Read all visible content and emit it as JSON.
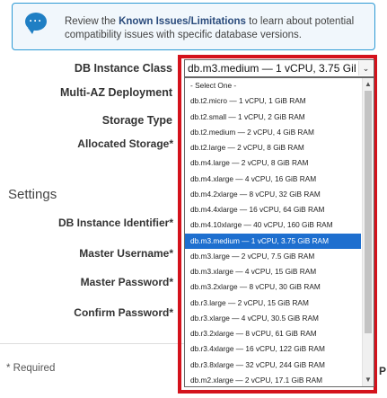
{
  "notice": {
    "icon": "speech-bubble-icon",
    "text_before": "Review the ",
    "link": "Known Issues/Limitations",
    "text_after": " to learn about potential compatibility issues with specific database versions."
  },
  "form": {
    "db_instance_class_label": "DB Instance Class",
    "multi_az_label": "Multi-AZ Deployment",
    "storage_type_label": "Storage Type",
    "allocated_storage_label": "Allocated Storage*",
    "section_settings": "Settings",
    "db_instance_identifier_label": "DB Instance Identifier*",
    "master_username_label": "Master Username*",
    "master_password_label": "Master Password*",
    "confirm_password_label": "Confirm Password*",
    "required_note": "* Required",
    "edge_fragment": "P"
  },
  "select": {
    "value": "db.m3.medium — 1 vCPU, 3.75 GiB RAM",
    "selected_index": 10,
    "options": [
      "- Select One -",
      "db.t2.micro — 1 vCPU, 1 GiB RAM",
      "db.t2.small — 1 vCPU, 2 GiB RAM",
      "db.t2.medium — 2 vCPU, 4 GiB RAM",
      "db.t2.large — 2 vCPU, 8 GiB RAM",
      "db.m4.large — 2 vCPU, 8 GiB RAM",
      "db.m4.xlarge — 4 vCPU, 16 GiB RAM",
      "db.m4.2xlarge — 8 vCPU, 32 GiB RAM",
      "db.m4.4xlarge — 16 vCPU, 64 GiB RAM",
      "db.m4.10xlarge — 40 vCPU, 160 GiB RAM",
      "db.m3.medium — 1 vCPU, 3.75 GiB RAM",
      "db.m3.large — 2 vCPU, 7.5 GiB RAM",
      "db.m3.xlarge — 4 vCPU, 15 GiB RAM",
      "db.m3.2xlarge — 8 vCPU, 30 GiB RAM",
      "db.r3.large — 2 vCPU, 15 GiB RAM",
      "db.r3.xlarge — 4 vCPU, 30.5 GiB RAM",
      "db.r3.2xlarge — 8 vCPU, 61 GiB RAM",
      "db.r3.4xlarge — 16 vCPU, 122 GiB RAM",
      "db.r3.8xlarge — 32 vCPU, 244 GiB RAM",
      "db.m2.xlarge — 2 vCPU, 17.1 GiB RAM"
    ]
  },
  "colors": {
    "highlight_border": "#d4121c",
    "selected_option": "#1e6fcf",
    "notice_border": "#2d9ad5",
    "link": "#2a4b7c"
  }
}
